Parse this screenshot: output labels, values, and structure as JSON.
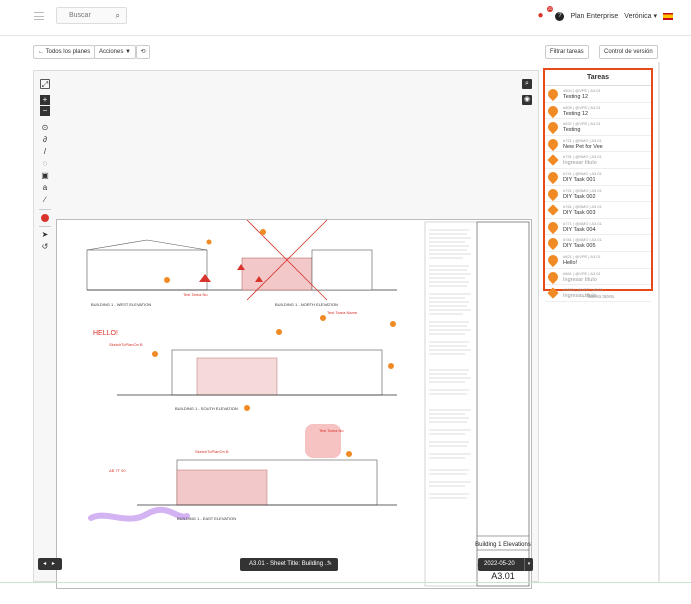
{
  "header": {
    "search_placeholder": "Buscar",
    "notifications_count": "22",
    "plan": "Plan Enterprise",
    "user": "Verónica ▾"
  },
  "toolbar": {
    "back_label": "← Todos los planes",
    "actions_label": "Acciones ▼",
    "filter_label": "Filtrar tareas",
    "version_label": "Control de versión"
  },
  "tasks_panel": {
    "title": "Tareas",
    "items": [
      {
        "ref": "#504 | @VPE | A3.01",
        "name": "Testing 12",
        "muted": false,
        "shape": "pin"
      },
      {
        "ref": "#505 | @VPE | A3.01",
        "name": "Testing 12",
        "muted": false,
        "shape": "pin"
      },
      {
        "ref": "#537 | @VPE | A3.01",
        "name": "Testing",
        "muted": false,
        "shape": "pin"
      },
      {
        "ref": "#721 | @BMO | A3.01",
        "name": "New Pet for Vee",
        "muted": false,
        "shape": "pin"
      },
      {
        "ref": "#731 | @BMO | A3.01",
        "name": "Ingresar título",
        "muted": true,
        "shape": "diamond"
      },
      {
        "ref": "#741 | @BMO | A3.01",
        "name": "DIY Task 001",
        "muted": false,
        "shape": "pin"
      },
      {
        "ref": "#751 | @BMO | A3.01",
        "name": "DIY Task 002",
        "muted": false,
        "shape": "pin"
      },
      {
        "ref": "#761 | @BMO | A3.01",
        "name": "DIY Task 003",
        "muted": false,
        "shape": "diamond"
      },
      {
        "ref": "#771 | @BMO | A3.01",
        "name": "DIY Task 004",
        "muted": false,
        "shape": "pin"
      },
      {
        "ref": "#781 | @BMO | A3.01",
        "name": "DIY Task 005",
        "muted": false,
        "shape": "pin"
      },
      {
        "ref": "#821 | @VPE | A3.01",
        "name": "Hello!",
        "muted": false,
        "shape": "pin"
      },
      {
        "ref": "#861 | @VPE | A3.01",
        "name": "Ingresar título",
        "muted": true,
        "shape": "pin"
      },
      {
        "ref": "#1001 | @VPE | A3.01",
        "name": "Ingresar título",
        "muted": true,
        "shape": "diamond"
      }
    ],
    "new_task_label": "+ Nueva tarea"
  },
  "drawing": {
    "sheet_number": "A3.01",
    "sheet_name": "Building 1 Elevations",
    "hello_label": "HELLO!",
    "annotations": [
      "Test Tarea No",
      "Test Tarea Name",
      "Test Tarea No",
      "SketchToPlanOn B",
      "SketchToPlanOn B",
      "AB 7T 90"
    ],
    "elevation_labels": [
      "BUILDING 1 - WEST ELEVATION",
      "BUILDING 1 - NORTH ELEVATION",
      "BUILDING 1 - SOUTH ELEVATION",
      "BUILDING 1 - EAST ELEVATION"
    ]
  },
  "footer": {
    "sheet_title": "A3.01 - Sheet Title: Building ...",
    "date": "2022-05-20",
    "nav_arrows": "◂ ▸"
  },
  "colors": {
    "accent": "#e64a19",
    "pin": "#f08a24",
    "markup_red": "#d9342b",
    "highlight_purple": "#c9a0f0"
  }
}
